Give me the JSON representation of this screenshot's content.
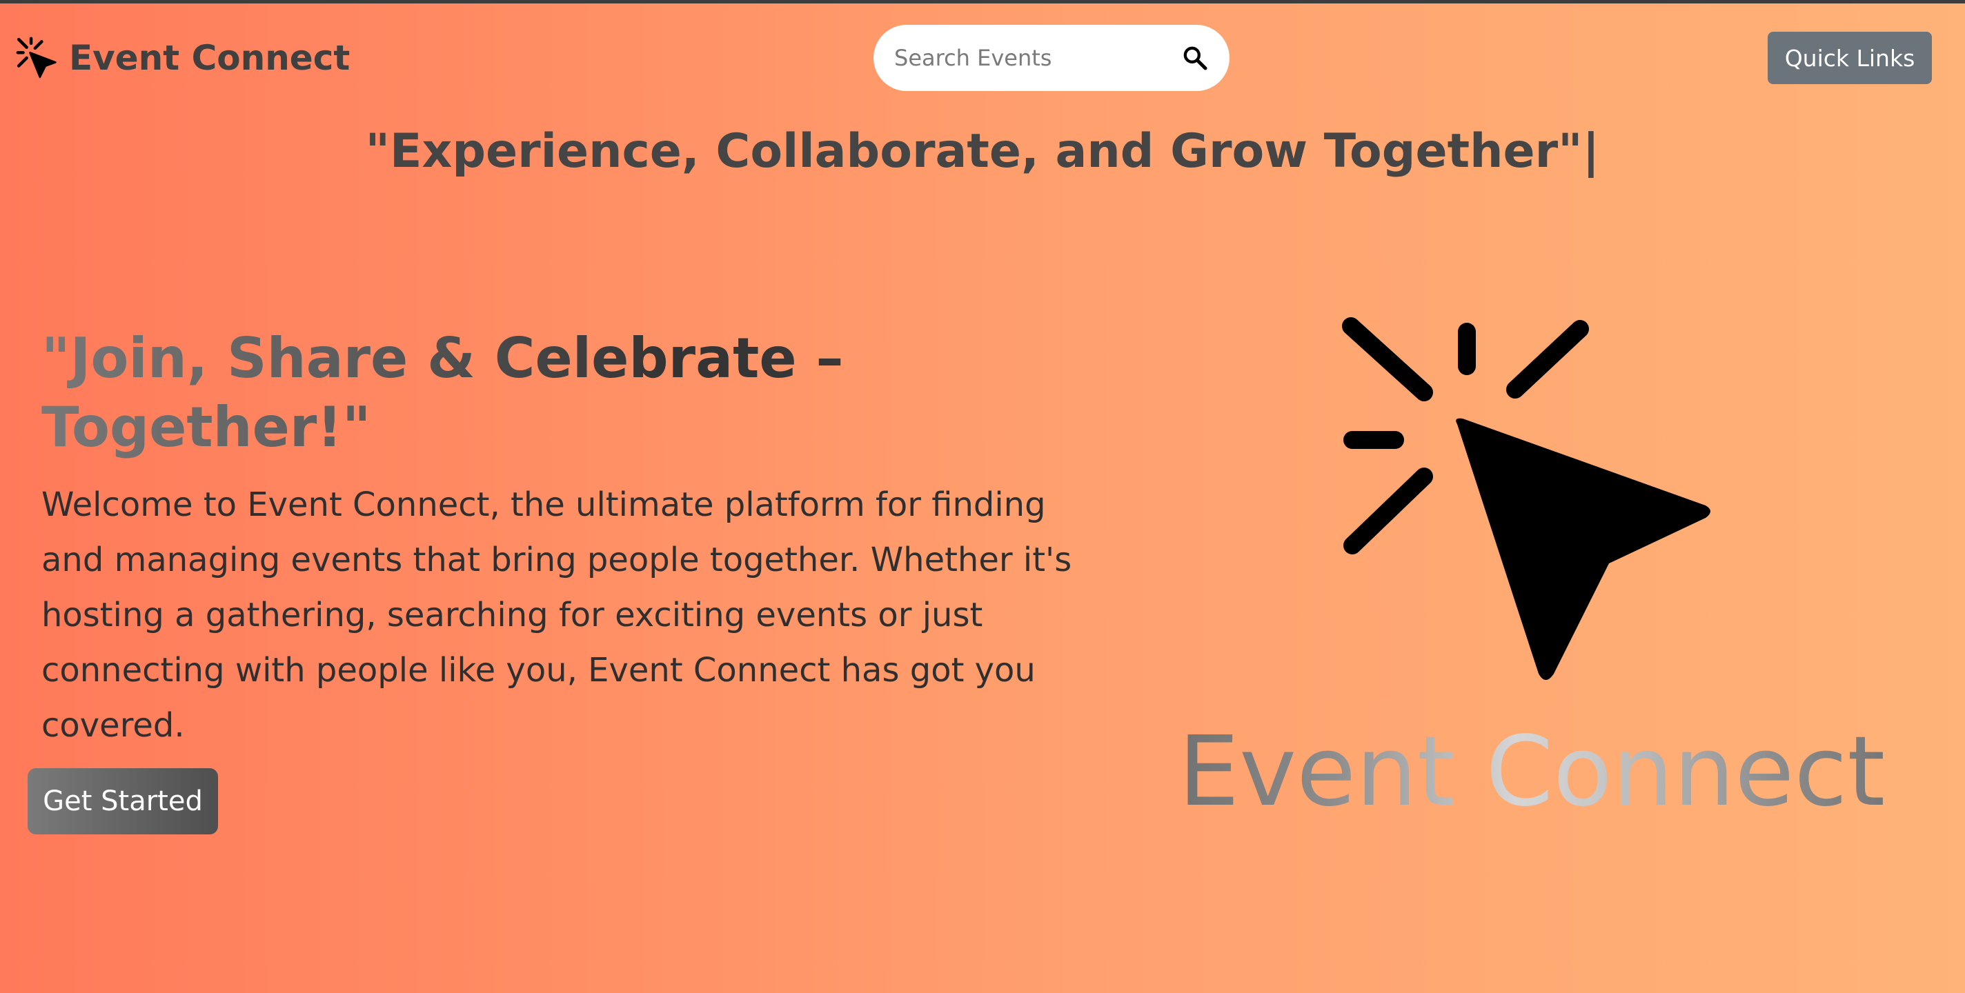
{
  "header": {
    "brand_name": "Event Connect",
    "brand_icon": "cursor-click-icon",
    "search": {
      "placeholder": "Search Events",
      "value": "",
      "icon": "search-icon"
    },
    "quick_links_label": "Quick Links"
  },
  "tagline": "\"Experience, Collaborate, and Grow Together\"|",
  "hero": {
    "title": "\"Join, Share & Celebrate – Together!\"",
    "description": "Welcome to Event Connect, the ultimate platform for finding and managing events that bring people together. Whether it's hosting a gathering, searching for exciting events or just connecting with people like you, Event Connect has got you covered.",
    "cta_label": "Get Started",
    "graphic_icon": "cursor-click-icon",
    "wordmark": "Event Connect"
  },
  "colors": {
    "background_start": "#ff7a5a",
    "background_end": "#ffb378",
    "quick_links_bg": "#6b737b",
    "text_dark": "#404040"
  }
}
